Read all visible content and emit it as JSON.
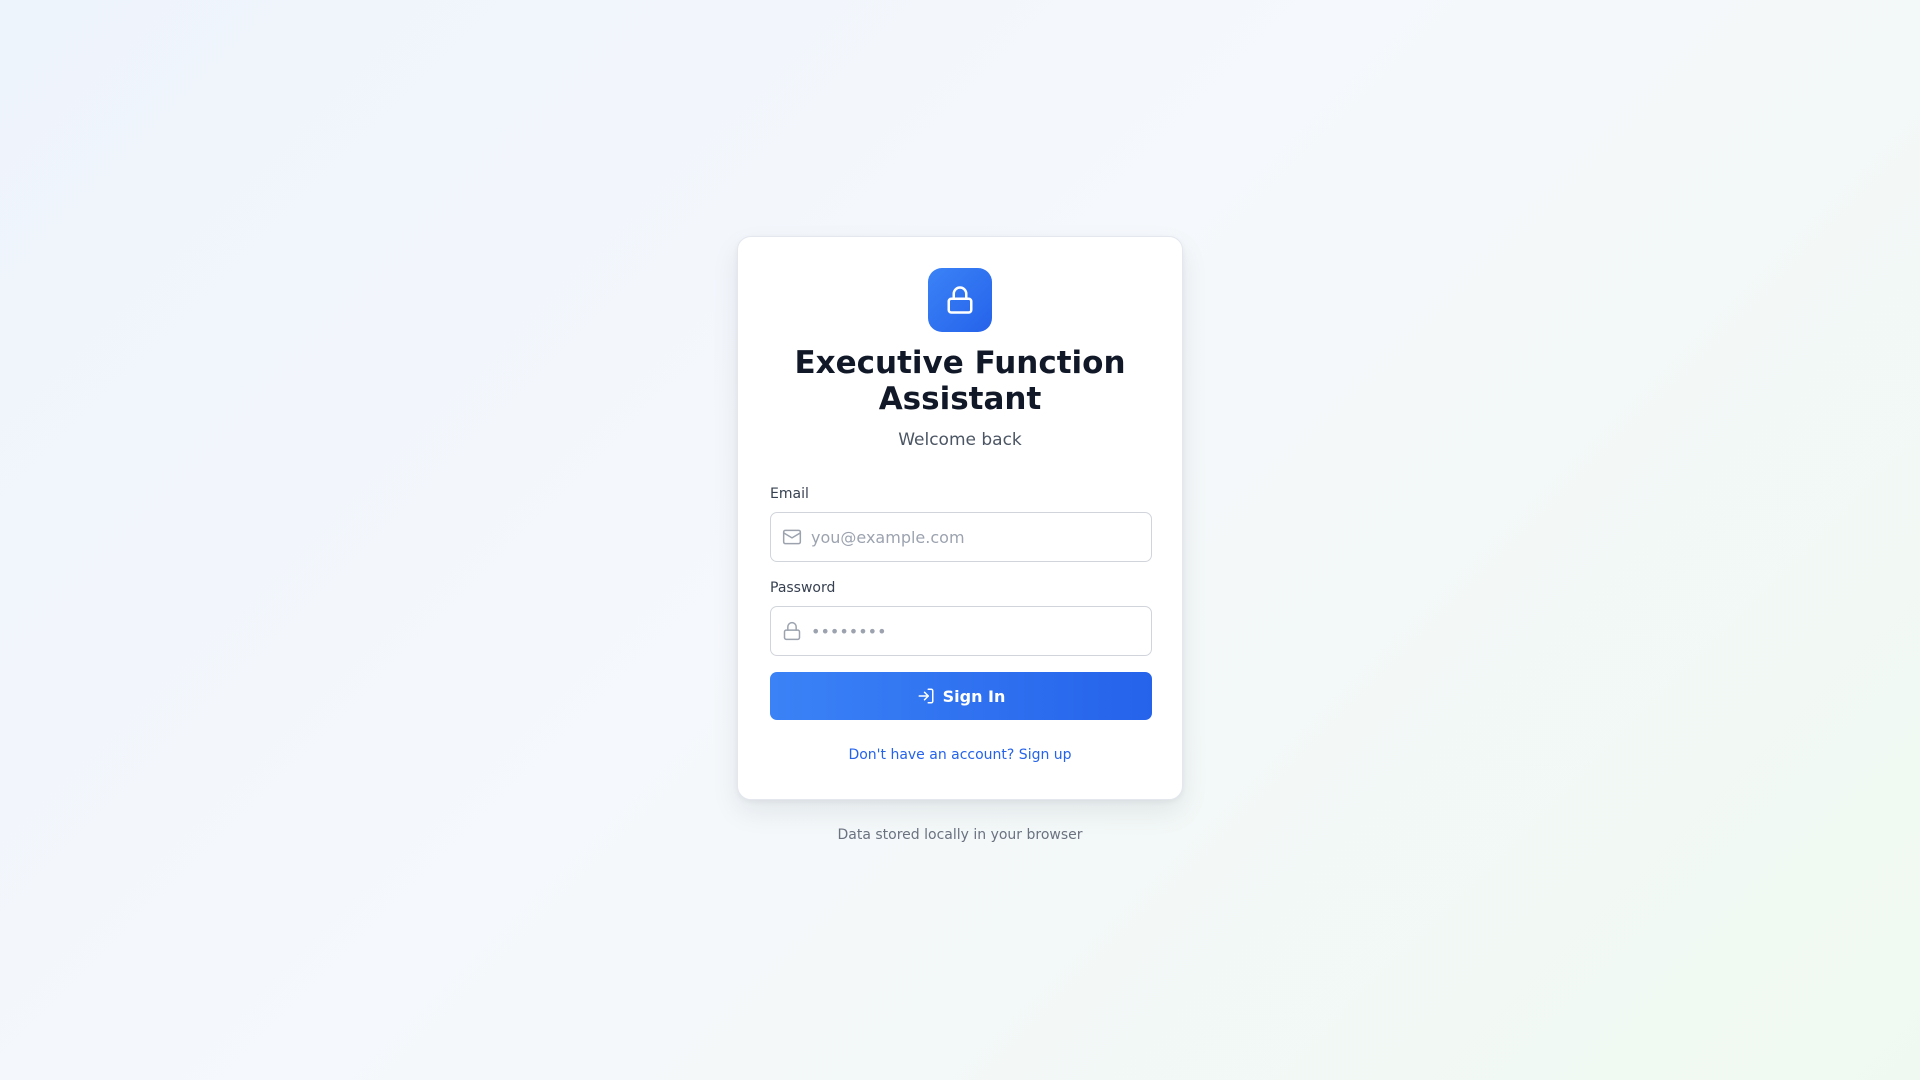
{
  "app": {
    "title": "Executive Function Assistant",
    "subtitle": "Welcome back"
  },
  "form": {
    "email_label": "Email",
    "email_placeholder": "you@example.com",
    "email_value": "",
    "password_label": "Password",
    "password_placeholder": "••••••••",
    "password_value": "",
    "submit_label": "Sign In",
    "signup_link": "Don't have an account? Sign up"
  },
  "footer": {
    "note": "Data stored locally in your browser"
  },
  "icons": {
    "logo": "lock-icon",
    "email_field": "mail-icon",
    "password_field": "lock-icon",
    "submit": "log-in-icon"
  },
  "colors": {
    "accent": "#2563eb",
    "accent_light": "#3b82f6",
    "title": "#111827",
    "muted": "#6b7280"
  }
}
